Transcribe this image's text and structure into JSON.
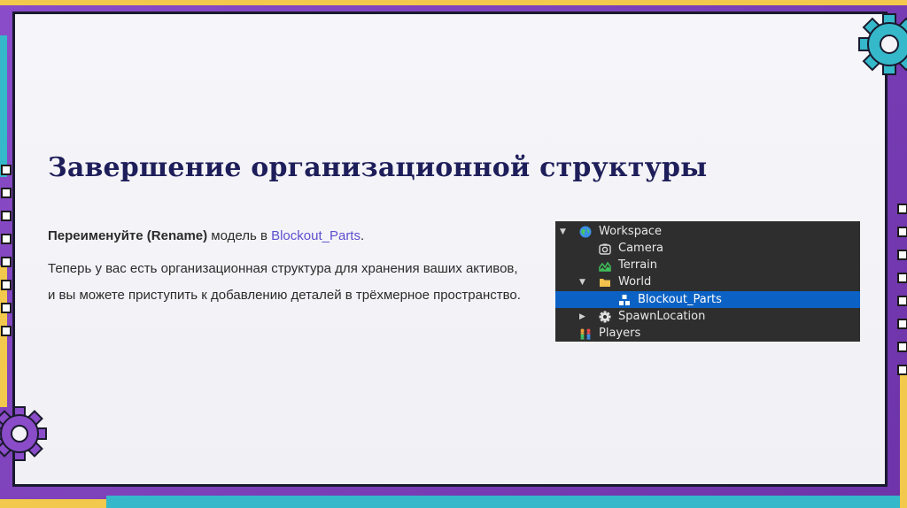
{
  "slide": {
    "title": "Завершение организационной структуры",
    "paragraph1": {
      "bold": "Переименуйте (Rename)",
      "middle": " модель в ",
      "link": "Blockout_Parts",
      "end": "."
    },
    "paragraph2": "Теперь у вас есть организационная структура для хранения ваших активов, и вы можете приступить к добавлению деталей в трёхмерное пространство."
  },
  "explorer": {
    "items": [
      {
        "label": "Workspace",
        "icon": "globe-icon",
        "expanded": true
      },
      {
        "label": "Camera",
        "icon": "camera-icon"
      },
      {
        "label": "Terrain",
        "icon": "terrain-icon"
      },
      {
        "label": "World",
        "icon": "folder-icon",
        "expanded": true
      },
      {
        "label": "Blockout_Parts",
        "icon": "model-icon",
        "selected": true
      },
      {
        "label": "SpawnLocation",
        "icon": "spawn-gear-icon",
        "expanded": false
      },
      {
        "label": "Players",
        "icon": "players-icon"
      }
    ]
  },
  "colors": {
    "frame": "#7a3fb8",
    "title": "#1e1e5a",
    "link": "#5b4fcf",
    "explorer_bg": "#2e2e2e",
    "selection": "#0b62c4"
  }
}
